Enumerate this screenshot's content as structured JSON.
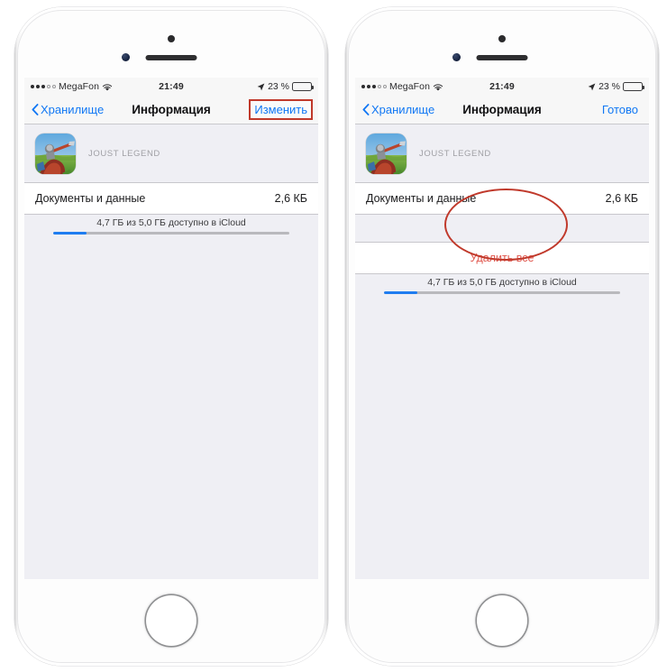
{
  "status_bar": {
    "signal_dots_filled": 3,
    "signal_dots_empty": 2,
    "carrier": "MegaFon",
    "wifi_icon": "wifi-icon",
    "time": "21:49",
    "location_icon": "location-arrow-icon",
    "battery_percent": "23 %",
    "battery_level": 23
  },
  "nav": {
    "back_icon": "chevron-left-icon",
    "back_label": "Хранилище",
    "title": "Информация",
    "action_left_phone": "Изменить",
    "action_right_phone": "Готово"
  },
  "app": {
    "icon_name": "joust-legend-app-icon",
    "name": "JOUST LEGEND"
  },
  "rows": {
    "documents_label": "Документы и данные",
    "documents_value": "2,6 КБ",
    "delete_all_label": "Удалить все"
  },
  "footer": {
    "storage_text": "4,7 ГБ из 5,0 ГБ доступно в iCloud",
    "progress_percent": 14
  },
  "annotations": {
    "edit_button_highlight_color": "#c0392b",
    "delete_all_ellipse_color": "#c0392b"
  },
  "colors": {
    "accent_blue": "#1077f4",
    "destructive_red": "#e0584f",
    "screen_background": "#efeff4",
    "row_background": "#ffffff"
  }
}
